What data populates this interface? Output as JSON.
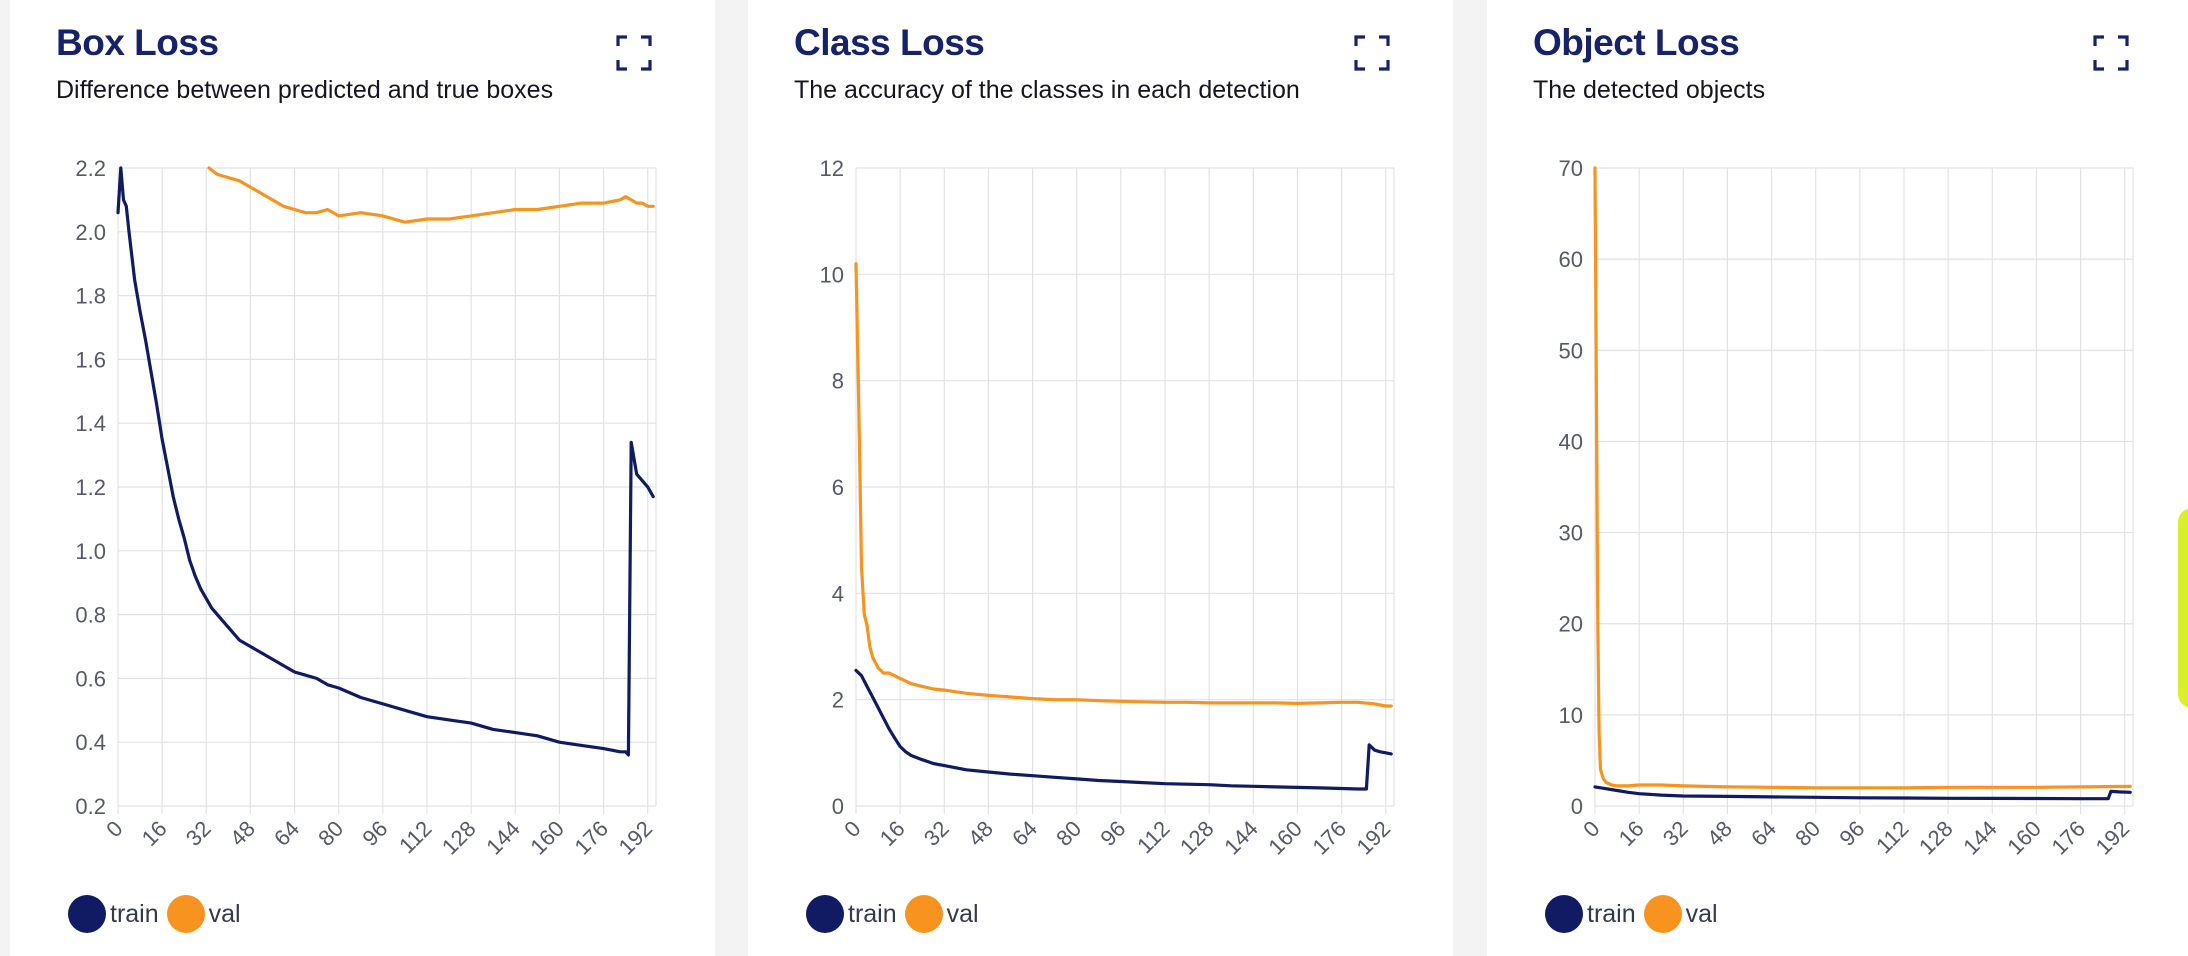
{
  "colors": {
    "train": "#101b63",
    "val": "#f7931e",
    "accent": "#d8f02a"
  },
  "icons": {
    "expand": "expand-icon"
  },
  "legend": {
    "train": "train",
    "val": "val"
  },
  "chart_data": [
    {
      "type": "line",
      "title": "Box Loss",
      "subtitle": "Difference between predicted and true boxes",
      "xlim": [
        0,
        195
      ],
      "ylim": [
        0.2,
        2.2
      ],
      "yticks": [
        "0.2",
        "0.4",
        "0.6",
        "0.8",
        "1.0",
        "1.2",
        "1.4",
        "1.6",
        "1.8",
        "2.0",
        "2.2"
      ],
      "xticks": [
        "0",
        "16",
        "32",
        "48",
        "64",
        "80",
        "96",
        "112",
        "128",
        "144",
        "160",
        "176",
        "192"
      ],
      "grid": true,
      "legend_position": "bottom-left",
      "series": [
        {
          "name": "train",
          "color": "#101b63",
          "x": [
            0,
            1,
            2,
            3,
            4,
            6,
            8,
            10,
            12,
            14,
            16,
            18,
            20,
            22,
            24,
            26,
            28,
            30,
            32,
            34,
            36,
            40,
            44,
            48,
            52,
            56,
            60,
            64,
            68,
            72,
            76,
            80,
            88,
            96,
            104,
            112,
            120,
            128,
            136,
            144,
            152,
            160,
            168,
            176,
            182,
            184,
            185,
            186,
            188,
            190,
            192,
            194
          ],
          "y": [
            2.06,
            2.2,
            2.1,
            2.08,
            2.0,
            1.85,
            1.75,
            1.66,
            1.56,
            1.46,
            1.35,
            1.26,
            1.17,
            1.1,
            1.04,
            0.97,
            0.92,
            0.88,
            0.85,
            0.82,
            0.8,
            0.76,
            0.72,
            0.7,
            0.68,
            0.66,
            0.64,
            0.62,
            0.61,
            0.6,
            0.58,
            0.57,
            0.54,
            0.52,
            0.5,
            0.48,
            0.47,
            0.46,
            0.44,
            0.43,
            0.42,
            0.4,
            0.39,
            0.38,
            0.37,
            0.37,
            0.36,
            1.34,
            1.24,
            1.22,
            1.2,
            1.17
          ]
        },
        {
          "name": "val",
          "color": "#f7931e",
          "x": [
            33,
            36,
            40,
            44,
            48,
            52,
            56,
            60,
            64,
            68,
            72,
            76,
            80,
            88,
            96,
            104,
            112,
            120,
            128,
            136,
            144,
            152,
            160,
            168,
            176,
            182,
            184,
            186,
            188,
            190,
            192,
            194
          ],
          "y": [
            2.2,
            2.18,
            2.17,
            2.16,
            2.14,
            2.12,
            2.1,
            2.08,
            2.07,
            2.06,
            2.06,
            2.07,
            2.05,
            2.06,
            2.05,
            2.03,
            2.04,
            2.04,
            2.05,
            2.06,
            2.07,
            2.07,
            2.08,
            2.09,
            2.09,
            2.1,
            2.11,
            2.1,
            2.09,
            2.09,
            2.08,
            2.08
          ]
        }
      ]
    },
    {
      "type": "line",
      "title": "Class Loss",
      "subtitle": "The accuracy of the classes in each detection",
      "xlim": [
        0,
        195
      ],
      "ylim": [
        0,
        12
      ],
      "yticks": [
        "0",
        "2",
        "4",
        "6",
        "8",
        "10",
        "12"
      ],
      "xticks": [
        "0",
        "16",
        "32",
        "48",
        "64",
        "80",
        "96",
        "112",
        "128",
        "144",
        "160",
        "176",
        "192"
      ],
      "grid": true,
      "legend_position": "bottom-left",
      "series": [
        {
          "name": "train",
          "color": "#101b63",
          "x": [
            0,
            2,
            4,
            6,
            8,
            10,
            12,
            14,
            16,
            18,
            20,
            24,
            28,
            32,
            36,
            40,
            48,
            56,
            64,
            72,
            80,
            88,
            96,
            104,
            112,
            120,
            128,
            136,
            144,
            152,
            160,
            168,
            176,
            182,
            185,
            186,
            188,
            190,
            192,
            194
          ],
          "y": [
            2.55,
            2.45,
            2.25,
            2.05,
            1.85,
            1.65,
            1.45,
            1.28,
            1.12,
            1.02,
            0.95,
            0.87,
            0.8,
            0.76,
            0.72,
            0.68,
            0.64,
            0.6,
            0.57,
            0.54,
            0.51,
            0.48,
            0.46,
            0.44,
            0.42,
            0.41,
            0.4,
            0.38,
            0.37,
            0.36,
            0.35,
            0.34,
            0.33,
            0.32,
            0.32,
            1.15,
            1.05,
            1.02,
            1.0,
            0.98
          ]
        },
        {
          "name": "val",
          "color": "#f7931e",
          "x": [
            0,
            1,
            2,
            3,
            4,
            5,
            6,
            7,
            8,
            10,
            12,
            14,
            16,
            18,
            20,
            24,
            28,
            32,
            36,
            40,
            48,
            56,
            64,
            72,
            80,
            88,
            96,
            104,
            112,
            120,
            128,
            136,
            144,
            152,
            160,
            168,
            176,
            182,
            188,
            190,
            192,
            194
          ],
          "y": [
            10.2,
            7.5,
            4.5,
            3.6,
            3.4,
            3.0,
            2.8,
            2.7,
            2.6,
            2.5,
            2.5,
            2.45,
            2.4,
            2.35,
            2.3,
            2.25,
            2.2,
            2.18,
            2.15,
            2.12,
            2.08,
            2.05,
            2.02,
            2.0,
            2.0,
            1.98,
            1.97,
            1.96,
            1.95,
            1.95,
            1.94,
            1.94,
            1.94,
            1.94,
            1.93,
            1.94,
            1.95,
            1.95,
            1.92,
            1.9,
            1.88,
            1.88
          ]
        }
      ]
    },
    {
      "type": "line",
      "title": "Object Loss",
      "subtitle": "The detected objects",
      "xlim": [
        0,
        195
      ],
      "ylim": [
        0,
        70
      ],
      "yticks": [
        "0",
        "10",
        "20",
        "30",
        "40",
        "50",
        "60",
        "70"
      ],
      "xticks": [
        "0",
        "16",
        "32",
        "48",
        "64",
        "80",
        "96",
        "112",
        "128",
        "144",
        "160",
        "176",
        "192"
      ],
      "grid": true,
      "legend_position": "bottom-left",
      "series": [
        {
          "name": "train",
          "color": "#101b63",
          "x": [
            0,
            4,
            8,
            12,
            16,
            24,
            32,
            48,
            64,
            80,
            96,
            112,
            128,
            144,
            160,
            176,
            186,
            187,
            190,
            194
          ],
          "y": [
            2.1,
            1.9,
            1.7,
            1.5,
            1.35,
            1.2,
            1.1,
            1.05,
            1.0,
            0.95,
            0.9,
            0.88,
            0.85,
            0.83,
            0.82,
            0.8,
            0.8,
            1.6,
            1.55,
            1.5
          ]
        },
        {
          "name": "val",
          "color": "#f7931e",
          "x": [
            0,
            0.5,
            1,
            1.5,
            2,
            3,
            4,
            6,
            8,
            12,
            16,
            24,
            32,
            48,
            64,
            80,
            96,
            112,
            128,
            144,
            160,
            176,
            194
          ],
          "y": [
            70,
            45,
            20,
            8,
            4,
            3,
            2.6,
            2.3,
            2.2,
            2.2,
            2.3,
            2.3,
            2.2,
            2.1,
            2.05,
            2.0,
            2.0,
            2.0,
            2.05,
            2.05,
            2.05,
            2.1,
            2.15
          ]
        }
      ]
    }
  ]
}
